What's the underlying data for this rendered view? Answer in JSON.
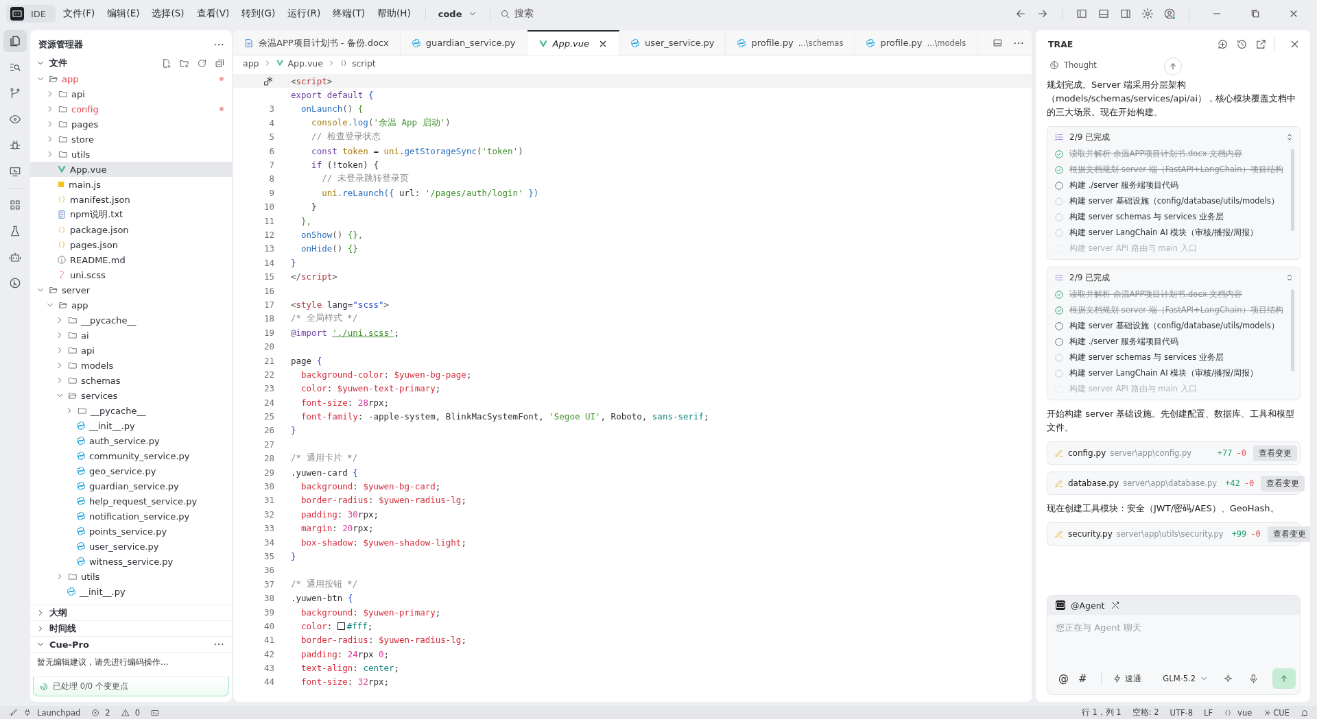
{
  "title_bar": {
    "app": "IDE",
    "menus": [
      "文件(F)",
      "编辑(E)",
      "选择(S)",
      "查看(V)",
      "转到(G)",
      "运行(R)",
      "终端(T)",
      "帮助(H)"
    ],
    "project": "code",
    "search": "搜索"
  },
  "activity_bar": [
    {
      "kind": "files",
      "selected": true
    },
    {
      "kind": "search",
      "selected": false
    },
    {
      "kind": "git",
      "selected": false
    },
    {
      "kind": "eye",
      "selected": false
    },
    {
      "kind": "bug",
      "selected": false
    },
    {
      "kind": "remote",
      "selected": false
    },
    {
      "kind": "grid",
      "selected": false
    },
    {
      "kind": "flask",
      "selected": false
    },
    {
      "kind": "robot",
      "selected": false
    },
    {
      "kind": "merge",
      "selected": false
    }
  ],
  "explorer": {
    "title": "资源管理器",
    "section": "文件",
    "tree": [
      {
        "name": "app",
        "kind": "folder",
        "expanded": true,
        "selected": false,
        "modified": true,
        "children": [
          {
            "name": "api",
            "kind": "folder",
            "expanded": false,
            "selected": false,
            "modified": false
          },
          {
            "name": "config",
            "kind": "folder",
            "expanded": false,
            "selected": false,
            "modified": true
          },
          {
            "name": "pages",
            "kind": "folder",
            "expanded": false,
            "selected": false,
            "modified": false
          },
          {
            "name": "store",
            "kind": "folder",
            "expanded": false,
            "selected": false,
            "modified": false
          },
          {
            "name": "utils",
            "kind": "folder",
            "expanded": false,
            "selected": false,
            "modified": false
          },
          {
            "name": "App.vue",
            "kind": "vue",
            "selected": true,
            "modified": false
          },
          {
            "name": "main.js",
            "kind": "js",
            "selected": false,
            "modified": false
          },
          {
            "name": "manifest.json",
            "kind": "json",
            "selected": false,
            "modified": false
          },
          {
            "name": "npm说明.txt",
            "kind": "txt",
            "selected": false,
            "modified": false
          },
          {
            "name": "package.json",
            "kind": "json",
            "selected": false,
            "modified": false
          },
          {
            "name": "pages.json",
            "kind": "json",
            "selected": false,
            "modified": false
          },
          {
            "name": "README.md",
            "kind": "info",
            "selected": false,
            "modified": false
          },
          {
            "name": "uni.scss",
            "kind": "scss",
            "selected": false,
            "modified": false
          }
        ]
      },
      {
        "name": "server",
        "kind": "folder",
        "expanded": true,
        "selected": false,
        "modified": false,
        "children": [
          {
            "name": "app",
            "kind": "folder",
            "expanded": true,
            "selected": false,
            "modified": false,
            "children": [
              {
                "name": "__pycache__",
                "kind": "folder",
                "expanded": false,
                "selected": false,
                "modified": false
              },
              {
                "name": "ai",
                "kind": "folder",
                "expanded": false,
                "selected": false,
                "modified": false
              },
              {
                "name": "api",
                "kind": "folder",
                "expanded": false,
                "selected": false,
                "modified": false
              },
              {
                "name": "models",
                "kind": "folder",
                "expanded": false,
                "selected": false,
                "modified": false
              },
              {
                "name": "schemas",
                "kind": "folder",
                "expanded": false,
                "selected": false,
                "modified": false
              },
              {
                "name": "services",
                "kind": "folder",
                "expanded": true,
                "selected": false,
                "modified": false,
                "children": [
                  {
                    "name": "__pycache__",
                    "kind": "folder",
                    "expanded": false,
                    "selected": false,
                    "modified": false
                  },
                  {
                    "name": "__init__.py",
                    "kind": "py",
                    "selected": false,
                    "modified": false
                  },
                  {
                    "name": "auth_service.py",
                    "kind": "py",
                    "selected": false,
                    "modified": false
                  },
                  {
                    "name": "community_service.py",
                    "kind": "py",
                    "selected": false,
                    "modified": false
                  },
                  {
                    "name": "geo_service.py",
                    "kind": "py",
                    "selected": false,
                    "modified": false
                  },
                  {
                    "name": "guardian_service.py",
                    "kind": "py",
                    "selected": false,
                    "modified": false
                  },
                  {
                    "name": "help_request_service.py",
                    "kind": "py",
                    "selected": false,
                    "modified": false
                  },
                  {
                    "name": "notification_service.py",
                    "kind": "py",
                    "selected": false,
                    "modified": false
                  },
                  {
                    "name": "points_service.py",
                    "kind": "py",
                    "selected": false,
                    "modified": false
                  },
                  {
                    "name": "user_service.py",
                    "kind": "py",
                    "selected": false,
                    "modified": false
                  },
                  {
                    "name": "witness_service.py",
                    "kind": "py",
                    "selected": false,
                    "modified": false
                  }
                ]
              },
              {
                "name": "utils",
                "kind": "folder",
                "expanded": false,
                "selected": false,
                "modified": false
              },
              {
                "name": "__init__.py",
                "kind": "py",
                "selected": false,
                "modified": false
              }
            ]
          }
        ]
      }
    ],
    "panels": [
      {
        "label": "大纲",
        "expanded": false
      },
      {
        "label": "时间线",
        "expanded": false
      },
      {
        "label": "Cue-Pro",
        "expanded": true
      }
    ],
    "cue_pro": {
      "message": "暂无编辑建议，请先进行编码操作...",
      "status": "已处理 0/0 个变更点"
    }
  },
  "editor": {
    "tabs": [
      {
        "label": "余温APP项目计划书 - 备份.docx",
        "kind": "docx",
        "selected": false
      },
      {
        "label": "guardian_service.py",
        "kind": "py",
        "selected": false
      },
      {
        "label": "App.vue",
        "kind": "vue",
        "selected": true
      },
      {
        "label": "user_service.py",
        "kind": "py",
        "selected": false
      },
      {
        "label": "profile.py",
        "detail": "...\\schemas",
        "kind": "py",
        "selected": false
      },
      {
        "label": "profile.py",
        "detail": "...\\models",
        "kind": "py",
        "selected": false
      }
    ],
    "breadcrumb": [
      {
        "label": "app",
        "kind": "folder"
      },
      {
        "label": "App.vue",
        "kind": "vue"
      },
      {
        "label": "script",
        "kind": "symbol"
      }
    ],
    "lines": [
      {
        "current": true,
        "modified": true,
        "tokens": [
          {
            "text": "<",
            "kind": "pu"
          },
          {
            "text": "script",
            "kind": "tag"
          },
          {
            "text": ">",
            "kind": "pu"
          }
        ]
      },
      {
        "current": false,
        "modified": false,
        "tokens": [
          {
            "text": "export default ",
            "kind": "kw"
          },
          {
            "text": "{",
            "kind": "br"
          }
        ]
      },
      {
        "number": "3",
        "current": false,
        "modified": false,
        "tokens": [
          {
            "text": "  onLaunch",
            "kind": "fn"
          },
          {
            "text": "() ",
            "kind": "pu"
          },
          {
            "text": "{",
            "kind": "br2"
          }
        ]
      },
      {
        "number": "4",
        "current": false,
        "modified": false,
        "tokens": [
          {
            "text": "    console",
            "kind": "obj"
          },
          {
            "text": ".log",
            "kind": "fn"
          },
          {
            "text": "(",
            "kind": "pu"
          },
          {
            "text": "'余温 App 启动'",
            "kind": "str"
          },
          {
            "text": ")",
            "kind": "pu"
          }
        ]
      },
      {
        "number": "5",
        "current": false,
        "modified": false,
        "tokens": [
          {
            "text": "    // 检查登录状态",
            "kind": "cm"
          }
        ]
      },
      {
        "number": "6",
        "current": false,
        "modified": false,
        "tokens": [
          {
            "text": "    const ",
            "kind": "kw"
          },
          {
            "text": "token",
            "kind": "obj"
          },
          {
            "text": " = ",
            "kind": "p"
          },
          {
            "text": "uni",
            "kind": "obj"
          },
          {
            "text": ".getStorageSync",
            "kind": "fn"
          },
          {
            "text": "(",
            "kind": "pu"
          },
          {
            "text": "'token'",
            "kind": "str"
          },
          {
            "text": ")",
            "kind": "pu"
          }
        ]
      },
      {
        "number": "7",
        "current": false,
        "modified": false,
        "tokens": [
          {
            "text": "    if ",
            "kind": "kw"
          },
          {
            "text": "(!token) {",
            "kind": "p"
          }
        ]
      },
      {
        "number": "8",
        "current": false,
        "modified": false,
        "tokens": [
          {
            "text": "      // 未登录跳转登录页",
            "kind": "cm"
          }
        ]
      },
      {
        "number": "9",
        "current": false,
        "modified": false,
        "tokens": [
          {
            "text": "      uni",
            "kind": "obj"
          },
          {
            "text": ".reLaunch({",
            "kind": "fn"
          },
          {
            "text": " url: ",
            "kind": "p"
          },
          {
            "text": "'/pages/auth/login'",
            "kind": "str"
          },
          {
            "text": " })",
            "kind": "fn"
          }
        ]
      },
      {
        "number": "10",
        "current": false,
        "modified": false,
        "tokens": [
          {
            "text": "    }",
            "kind": "p"
          }
        ]
      },
      {
        "number": "11",
        "current": false,
        "modified": false,
        "tokens": [
          {
            "text": "  },",
            "kind": "br2"
          }
        ]
      },
      {
        "number": "12",
        "current": false,
        "modified": false,
        "tokens": [
          {
            "text": "  onShow",
            "kind": "fn"
          },
          {
            "text": "() ",
            "kind": "pu"
          },
          {
            "text": "{},",
            "kind": "br2"
          }
        ]
      },
      {
        "number": "13",
        "current": false,
        "modified": false,
        "tokens": [
          {
            "text": "  onHide",
            "kind": "fn"
          },
          {
            "text": "() ",
            "kind": "pu"
          },
          {
            "text": "{}",
            "kind": "br2"
          }
        ]
      },
      {
        "number": "14",
        "current": false,
        "modified": false,
        "tokens": [
          {
            "text": "}",
            "kind": "br"
          }
        ]
      },
      {
        "number": "15",
        "current": false,
        "modified": false,
        "tokens": [
          {
            "text": "</",
            "kind": "pu"
          },
          {
            "text": "script",
            "kind": "tag"
          },
          {
            "text": ">",
            "kind": "pu"
          }
        ]
      },
      {
        "number": "16",
        "current": false,
        "modified": false
      },
      {
        "number": "17",
        "current": false,
        "modified": false,
        "tokens": [
          {
            "text": "<",
            "kind": "pu"
          },
          {
            "text": "style",
            "kind": "tag"
          },
          {
            "text": " lang=",
            "kind": "p"
          },
          {
            "text": "\"scss\"",
            "kind": "br"
          },
          {
            "text": ">",
            "kind": "pu"
          }
        ]
      },
      {
        "number": "18",
        "current": false,
        "modified": false,
        "tokens": [
          {
            "text": "/* 全局样式 */",
            "kind": "cm"
          }
        ]
      },
      {
        "number": "19",
        "current": false,
        "modified": false,
        "tokens": [
          {
            "text": "@import ",
            "kind": "kw"
          },
          {
            "text": "'./uni.scss'",
            "kind": "imp"
          },
          {
            "text": ";",
            "kind": "p"
          }
        ]
      },
      {
        "number": "20",
        "current": false,
        "modified": false
      },
      {
        "number": "21",
        "current": false,
        "modified": false,
        "tokens": [
          {
            "text": "page ",
            "kind": "p"
          },
          {
            "text": "{",
            "kind": "br"
          }
        ]
      },
      {
        "number": "22",
        "current": false,
        "modified": false,
        "tokens": [
          {
            "text": "  background-color",
            "kind": "prop"
          },
          {
            "text": ": ",
            "kind": "p"
          },
          {
            "text": "$yuwen-bg-page",
            "kind": "var"
          },
          {
            "text": ";",
            "kind": "p"
          }
        ]
      },
      {
        "number": "23",
        "current": false,
        "modified": false,
        "tokens": [
          {
            "text": "  color",
            "kind": "prop"
          },
          {
            "text": ": ",
            "kind": "p"
          },
          {
            "text": "$yuwen-text-primary",
            "kind": "var"
          },
          {
            "text": ";",
            "kind": "p"
          }
        ]
      },
      {
        "number": "24",
        "current": false,
        "modified": false,
        "tokens": [
          {
            "text": "  font-size",
            "kind": "prop"
          },
          {
            "text": ": ",
            "kind": "p"
          },
          {
            "text": "28",
            "kind": "num"
          },
          {
            "text": "rpx;",
            "kind": "p"
          }
        ]
      },
      {
        "number": "25",
        "current": false,
        "modified": false,
        "tokens": [
          {
            "text": "  font-family",
            "kind": "prop"
          },
          {
            "text": ": -apple-system, BlinkMacSystemFont, ",
            "kind": "p"
          },
          {
            "text": "'Segoe UI'",
            "kind": "str"
          },
          {
            "text": ", Roboto, ",
            "kind": "p"
          },
          {
            "text": "sans-serif",
            "kind": "val"
          },
          {
            "text": ";",
            "kind": "p"
          }
        ]
      },
      {
        "number": "26",
        "current": false,
        "modified": false,
        "tokens": [
          {
            "text": "}",
            "kind": "br"
          }
        ]
      },
      {
        "number": "27",
        "current": false,
        "modified": false
      },
      {
        "number": "28",
        "current": false,
        "modified": false,
        "tokens": [
          {
            "text": "/* 通用卡片 */",
            "kind": "cm"
          }
        ]
      },
      {
        "number": "29",
        "current": false,
        "modified": false,
        "tokens": [
          {
            "text": ".yuwen-card ",
            "kind": "p"
          },
          {
            "text": "{",
            "kind": "br"
          }
        ]
      },
      {
        "number": "30",
        "current": false,
        "modified": false,
        "tokens": [
          {
            "text": "  background",
            "kind": "prop"
          },
          {
            "text": ": ",
            "kind": "p"
          },
          {
            "text": "$yuwen-bg-card",
            "kind": "var"
          },
          {
            "text": ";",
            "kind": "p"
          }
        ]
      },
      {
        "number": "31",
        "current": false,
        "modified": false,
        "tokens": [
          {
            "text": "  border-radius",
            "kind": "prop"
          },
          {
            "text": ": ",
            "kind": "p"
          },
          {
            "text": "$yuwen-radius-lg",
            "kind": "var"
          },
          {
            "text": ";",
            "kind": "p"
          }
        ]
      },
      {
        "number": "32",
        "current": false,
        "modified": false,
        "tokens": [
          {
            "text": "  padding",
            "kind": "prop"
          },
          {
            "text": ": ",
            "kind": "p"
          },
          {
            "text": "30",
            "kind": "num"
          },
          {
            "text": "rpx;",
            "kind": "p"
          }
        ]
      },
      {
        "number": "33",
        "current": false,
        "modified": false,
        "tokens": [
          {
            "text": "  margin",
            "kind": "prop"
          },
          {
            "text": ": ",
            "kind": "p"
          },
          {
            "text": "20",
            "kind": "num"
          },
          {
            "text": "rpx;",
            "kind": "p"
          }
        ]
      },
      {
        "number": "34",
        "current": false,
        "modified": false,
        "tokens": [
          {
            "text": "  box-shadow",
            "kind": "prop"
          },
          {
            "text": ": ",
            "kind": "p"
          },
          {
            "text": "$yuwen-shadow-light",
            "kind": "var"
          },
          {
            "text": ";",
            "kind": "p"
          }
        ]
      },
      {
        "number": "35",
        "current": false,
        "modified": false,
        "tokens": [
          {
            "text": "}",
            "kind": "br"
          }
        ]
      },
      {
        "number": "36",
        "current": false,
        "modified": false
      },
      {
        "number": "37",
        "current": false,
        "modified": false,
        "tokens": [
          {
            "text": "/* 通用按钮 */",
            "kind": "cm"
          }
        ]
      },
      {
        "number": "38",
        "current": false,
        "modified": false,
        "tokens": [
          {
            "text": ".yuwen-btn ",
            "kind": "p"
          },
          {
            "text": "{",
            "kind": "br"
          }
        ]
      },
      {
        "number": "39",
        "current": false,
        "modified": false,
        "tokens": [
          {
            "text": "  background",
            "kind": "prop"
          },
          {
            "text": ": ",
            "kind": "p"
          },
          {
            "text": "$yuwen-primary",
            "kind": "var"
          },
          {
            "text": ";",
            "kind": "p"
          }
        ]
      },
      {
        "number": "40",
        "current": false,
        "modified": false,
        "tokens": [
          {
            "text": "  color",
            "kind": "prop"
          },
          {
            "text": ": ",
            "kind": "p"
          },
          {
            "text": "#fff",
            "kind": "colorval"
          },
          {
            "text": ";",
            "kind": "p"
          }
        ]
      },
      {
        "number": "41",
        "current": false,
        "modified": false,
        "tokens": [
          {
            "text": "  border-radius",
            "kind": "prop"
          },
          {
            "text": ": ",
            "kind": "p"
          },
          {
            "text": "$yuwen-radius-lg",
            "kind": "var"
          },
          {
            "text": ";",
            "kind": "p"
          }
        ]
      },
      {
        "number": "42",
        "current": false,
        "modified": false,
        "tokens": [
          {
            "text": "  padding",
            "kind": "prop"
          },
          {
            "text": ": ",
            "kind": "p"
          },
          {
            "text": "24",
            "kind": "num"
          },
          {
            "text": "rpx ",
            "kind": "p"
          },
          {
            "text": "0",
            "kind": "num"
          },
          {
            "text": ";",
            "kind": "p"
          }
        ]
      },
      {
        "number": "43",
        "current": false,
        "modified": false,
        "tokens": [
          {
            "text": "  text-align",
            "kind": "prop"
          },
          {
            "text": ": ",
            "kind": "p"
          },
          {
            "text": "center",
            "kind": "val"
          },
          {
            "text": ";",
            "kind": "p"
          }
        ]
      },
      {
        "number": "44",
        "current": false,
        "modified": false,
        "tokens": [
          {
            "text": "  font-size",
            "kind": "prop"
          },
          {
            "text": ": ",
            "kind": "p"
          },
          {
            "text": "32",
            "kind": "num"
          },
          {
            "text": "rpx;",
            "kind": "p"
          }
        ]
      }
    ]
  },
  "assistant": {
    "title": "TRAE",
    "thought": "Thought",
    "feed": [
      {
        "kind": "text",
        "text": "规划完成。Server 端采用分层架构（models/schemas/services/api/ai），核心模块覆盖文档中的三大场景。现在开始构建。"
      },
      {
        "kind": "todo",
        "summary": "2/9 已完成",
        "items": [
          {
            "text": "读取并解析 余温APP项目计划书.docx 文档内容",
            "kind": "done"
          },
          {
            "text": "根据文档规划 server 端（FastAPI+LangChain）项目结构",
            "kind": "done"
          },
          {
            "text": "构建 ./server 服务端项目代码",
            "kind": "running"
          },
          {
            "text": "构建 server 基础设施（config/database/utils/models）",
            "kind": "pending"
          },
          {
            "text": "构建 server schemas 与 services 业务层",
            "kind": "pending"
          },
          {
            "text": "构建 server LangChain AI 模块（审核/播报/周报）",
            "kind": "pending"
          },
          {
            "text": "构建 server API 路由与 main 入口",
            "kind": "pending"
          }
        ]
      },
      {
        "kind": "todo",
        "summary": "2/9 已完成",
        "items": [
          {
            "text": "读取并解析 余温APP项目计划书.docx 文档内容",
            "kind": "done"
          },
          {
            "text": "根据文档规划 server 端（FastAPI+LangChain）项目结构",
            "kind": "done"
          },
          {
            "text": "构建 server 基础设施（config/database/utils/models）",
            "kind": "running"
          },
          {
            "text": "构建 ./server 服务端项目代码",
            "kind": "running"
          },
          {
            "text": "构建 server schemas 与 services 业务层",
            "kind": "pending"
          },
          {
            "text": "构建 server LangChain AI 模块（审核/播报/周报）",
            "kind": "pending"
          },
          {
            "text": "构建 server API 路由与 main 入口",
            "kind": "pending"
          }
        ]
      },
      {
        "kind": "text",
        "text": "开始构建 server 基础设施。先创建配置、数据库、工具和模型文件。"
      },
      {
        "kind": "file",
        "name": "config.py",
        "path": "server\\app\\config.py",
        "added": "+77",
        "removed": "-0",
        "action": "查看变更"
      },
      {
        "kind": "file",
        "name": "database.py",
        "path": "server\\app\\database.py",
        "added": "+42",
        "removed": "-0",
        "action": "查看变更"
      },
      {
        "kind": "text",
        "text": "现在创建工具模块：安全（JWT/密码/AES）、GeoHash。"
      },
      {
        "kind": "file",
        "name": "security.py",
        "path": "server\\app\\utils\\security.py",
        "added": "+99",
        "removed": "-0",
        "action": "查看变更"
      }
    ],
    "chat": {
      "agent": "@Agent",
      "placeholder": "您正在与 Agent 聊天",
      "tools": [
        "@",
        "#"
      ],
      "mode": "速通",
      "model": "GLM-5.2"
    }
  },
  "status_bar": {
    "launchpad": "Launchpad",
    "errors": "2",
    "warnings": "0",
    "position": "行 1，列 1",
    "indent": "空格: 2",
    "encoding": "UTF-8",
    "eol": "LF",
    "language": "vue",
    "plugin": "CUE"
  }
}
